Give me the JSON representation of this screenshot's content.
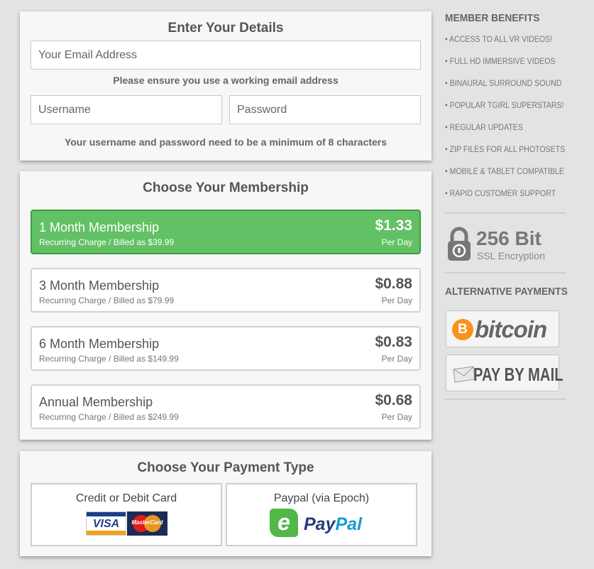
{
  "details": {
    "title": "Enter Your Details",
    "email_placeholder": "Your Email Address",
    "email_hint": "Please ensure you use a working email address",
    "username_placeholder": "Username",
    "password_placeholder": "Password",
    "credentials_hint": "Your username and password need to be a minimum of 8 characters"
  },
  "membership": {
    "title": "Choose Your Membership",
    "plans": [
      {
        "name": "1 Month Membership",
        "sub": "Recurring Charge / Billed as $39.99",
        "price": "$1.33",
        "per": "Per Day",
        "selected": true
      },
      {
        "name": "3 Month Membership",
        "sub": "Recurring Charge / Billed as $79.99",
        "price": "$0.88",
        "per": "Per Day",
        "selected": false
      },
      {
        "name": "6 Month Membership",
        "sub": "Recurring Charge / Billed as $149.99",
        "price": "$0.83",
        "per": "Per Day",
        "selected": false
      },
      {
        "name": "Annual Membership",
        "sub": "Recurring Charge / Billed as $249.99",
        "price": "$0.68",
        "per": "Per Day",
        "selected": false
      }
    ]
  },
  "payment": {
    "title": "Choose Your Payment Type",
    "card_label": "Credit or Debit Card",
    "card_logos": {
      "visa": "VISA",
      "mastercard": "MasterCard"
    },
    "paypal_label": "Paypal (via Epoch)",
    "paypal_logo": {
      "epoch_mark": "e",
      "pay": "Pay",
      "pal": "Pal"
    }
  },
  "sidebar": {
    "benefits_title": "MEMBER BENEFITS",
    "benefits": [
      "• ACCESS TO ALL VR VIDEOS!",
      "• FULL HD IMMERSIVE VIDEOS",
      "• BINAURAL SURROUND SOUND",
      "• POPULAR TGIRL SUPERSTARS!",
      "• REGULAR UPDATES",
      "• ZIP FILES FOR ALL PHOTOSETS",
      "• MOBILE & TABLET COMPATIBLE",
      "• RAPID CUSTOMER SUPPORT"
    ],
    "ssl_big": "256 Bit",
    "ssl_small": "SSL Encryption",
    "alt_title": "ALTERNATIVE PAYMENTS",
    "bitcoin_symbol": "B",
    "bitcoin_label": "bitcoin",
    "mail_label": "PAY BY MAIL"
  },
  "colors": {
    "selected_plan": "#62c165",
    "selected_border": "#3b9c3f",
    "bitcoin_orange": "#f7931a",
    "paypal_dark": "#253b80",
    "paypal_light": "#179bd7",
    "epoch_green": "#51b848"
  }
}
